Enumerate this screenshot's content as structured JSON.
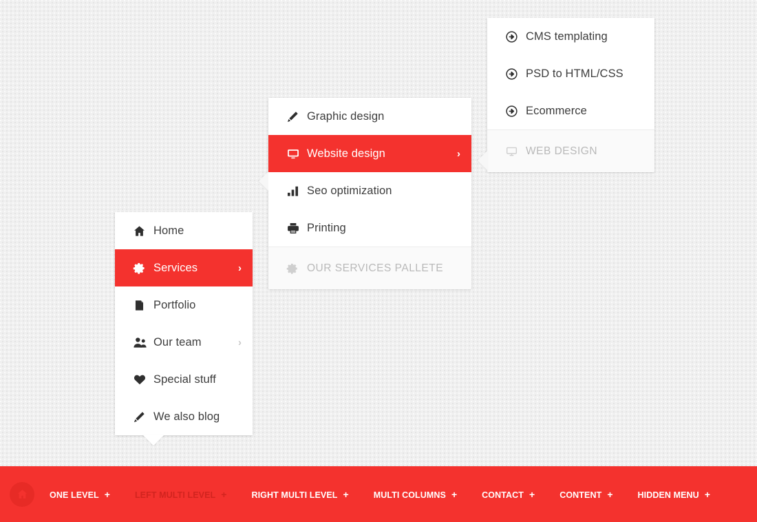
{
  "panels": {
    "main": {
      "name": "main-menu",
      "items": [
        {
          "label": "Home",
          "icon": "home-icon",
          "active": false,
          "chevron": ""
        },
        {
          "label": "Services",
          "icon": "gear-icon",
          "active": true,
          "chevron": "›"
        },
        {
          "label": "Portfolio",
          "icon": "book-icon",
          "active": false,
          "chevron": ""
        },
        {
          "label": "Our team",
          "icon": "users-icon",
          "active": false,
          "chevron": "›"
        },
        {
          "label": "Special stuff",
          "icon": "heart-icon",
          "active": false,
          "chevron": ""
        },
        {
          "label": "We also blog",
          "icon": "pencil-icon",
          "active": false,
          "chevron": ""
        }
      ]
    },
    "services": {
      "name": "services-submenu",
      "items": [
        {
          "label": "Graphic design",
          "icon": "pencil-icon",
          "active": false,
          "chevron": ""
        },
        {
          "label": "Website design",
          "icon": "monitor-icon",
          "active": true,
          "chevron": "›"
        },
        {
          "label": "Seo optimization",
          "icon": "bars-icon",
          "active": false,
          "chevron": ""
        },
        {
          "label": "Printing",
          "icon": "printer-icon",
          "active": false,
          "chevron": ""
        }
      ],
      "footer": {
        "label": "OUR SERVICES PALLETE",
        "icon": "gear-icon"
      }
    },
    "web": {
      "name": "web-design-submenu",
      "items": [
        {
          "label": "CMS templating",
          "icon": "arrow-circle-icon",
          "active": false,
          "chevron": ""
        },
        {
          "label": "PSD to HTML/CSS",
          "icon": "arrow-circle-icon",
          "active": false,
          "chevron": ""
        },
        {
          "label": "Ecommerce",
          "icon": "arrow-circle-icon",
          "active": false,
          "chevron": ""
        }
      ],
      "footer": {
        "label": "WEB DESIGN",
        "icon": "monitor-icon"
      }
    }
  },
  "bottom_bar": {
    "home_icon": "home-icon",
    "links": [
      {
        "label": "ONE LEVEL",
        "plus": "+",
        "current": false
      },
      {
        "label": "LEFT MULTI LEVEL",
        "plus": "+",
        "current": true
      },
      {
        "label": "RIGHT MULTI LEVEL",
        "plus": "+",
        "current": false
      },
      {
        "label": "MULTI COLUMNS",
        "plus": "+",
        "current": false
      },
      {
        "label": "CONTACT",
        "plus": "+",
        "current": false
      },
      {
        "label": "CONTENT",
        "plus": "+",
        "current": false
      },
      {
        "label": "HIDDEN MENU",
        "plus": "+",
        "current": false
      }
    ]
  },
  "colors": {
    "accent_red": "#f4322e",
    "bar_red": "#f4322e",
    "home_btn_red": "#e72b26",
    "text_dark": "#3c3c3c",
    "text_muted": "#b9b9b9",
    "panel_bg": "#ffffff",
    "panel_footer_bg": "#fafafa",
    "page_bg": "#f0f0f0"
  }
}
